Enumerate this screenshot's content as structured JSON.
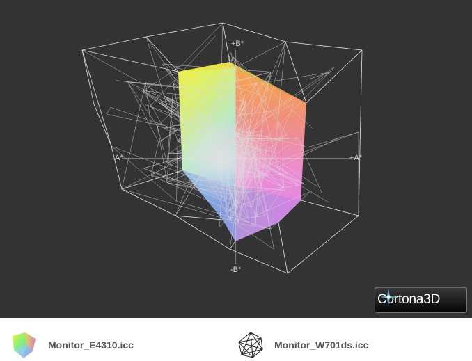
{
  "viewer": {
    "background": "#333333",
    "axes": {
      "b_pos": "+B*",
      "b_neg": "-B*",
      "a_pos": "+A*",
      "a_neg": "A*"
    },
    "brand": {
      "name": "Cortona",
      "suffix": "3D"
    }
  },
  "legend": {
    "items": [
      {
        "label": "Monitor_E4310.icc",
        "icon": "color-gamut-solid-icon"
      },
      {
        "label": "Monitor_W701ds.icc",
        "icon": "gamut-wireframe-icon"
      }
    ]
  }
}
